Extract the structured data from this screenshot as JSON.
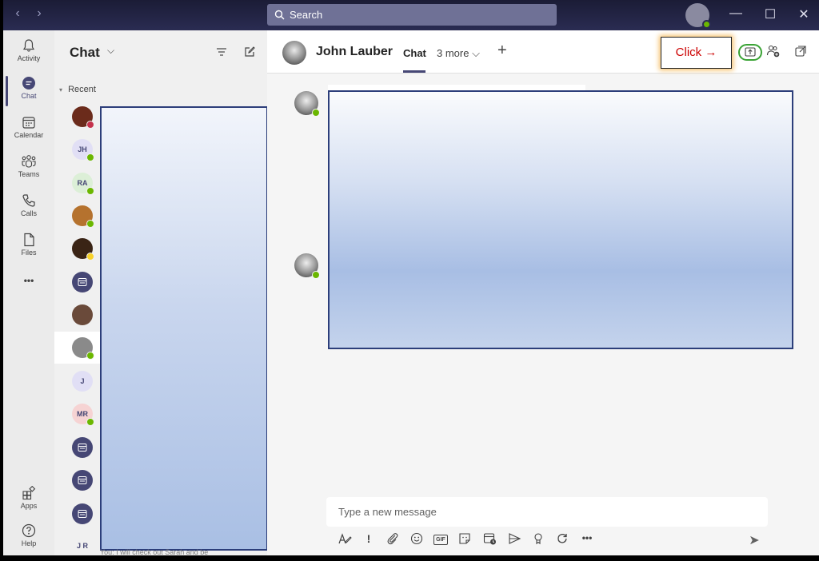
{
  "titlebar": {
    "back_glyph": "‹",
    "forward_glyph": "›",
    "search_placeholder": "Search",
    "minimize_glyph": "—",
    "maximize_glyph": "☐",
    "close_glyph": "✕"
  },
  "rail": {
    "items": [
      {
        "label": "Activity",
        "icon": "bell-icon"
      },
      {
        "label": "Chat",
        "icon": "chat-icon"
      },
      {
        "label": "Calendar",
        "icon": "calendar-icon"
      },
      {
        "label": "Teams",
        "icon": "teams-icon"
      },
      {
        "label": "Calls",
        "icon": "phone-icon"
      },
      {
        "label": "Files",
        "icon": "file-icon"
      }
    ],
    "more": "•••",
    "bottom": [
      {
        "label": "Apps",
        "icon": "apps-icon"
      },
      {
        "label": "Help",
        "icon": "help-icon"
      }
    ]
  },
  "chatlist": {
    "title": "Chat",
    "caret": "⌵",
    "section": "Recent",
    "section_caret": "▾",
    "contacts": [
      {
        "initials": "",
        "color": "#6b2b1b",
        "presence": "#c4314b"
      },
      {
        "initials": "JH",
        "color": "#e1dff5",
        "presence": "#6bb700"
      },
      {
        "initials": "RA",
        "color": "#dcefd7",
        "presence": "#6bb700"
      },
      {
        "initials": "",
        "color": "#b5722e",
        "presence": "#6bb700"
      },
      {
        "initials": "",
        "color": "#3a2415",
        "presence": "#f8d22a"
      },
      {
        "initials": "",
        "color": "#464775",
        "presence": ""
      },
      {
        "initials": "",
        "color": "#6a4a3a",
        "presence": ""
      },
      {
        "initials": "",
        "color": "#8a8a8a",
        "presence": "#6bb700"
      },
      {
        "initials": "J",
        "color": "#e1dff5",
        "presence": ""
      },
      {
        "initials": "MR",
        "color": "#f6d3d3",
        "presence": "#6bb700"
      },
      {
        "initials": "",
        "color": "#464775",
        "presence": ""
      },
      {
        "initials": "",
        "color": "#464775",
        "presence": ""
      },
      {
        "initials": "",
        "color": "#464775",
        "presence": ""
      },
      {
        "initials": "J R",
        "color": "#f0f0f0",
        "presence": ""
      }
    ],
    "truncated_preview": "You: I will check out Sarah and be"
  },
  "main": {
    "contact_name": "John Lauber",
    "tab_chat": "Chat",
    "tab_more": "3 more ⌵",
    "tab_add": "+",
    "callout": "Click →",
    "composer_placeholder": "Type a new message",
    "tools": [
      "format-icon",
      "important-icon",
      "attach-icon",
      "emoji-icon",
      "gif-icon",
      "sticker-icon",
      "schedule-meeting-icon",
      "stream-icon",
      "praise-icon",
      "loop-icon",
      "more-options-icon"
    ],
    "gif_label": "GIF",
    "more_label": "•••",
    "send_glyph": "➤"
  },
  "colors": {
    "brand": "#464775",
    "presence_available": "#6bb700",
    "callout_text": "#cc0000",
    "callout_glow": "#f6c26e",
    "share_highlight": "#3aa335"
  }
}
